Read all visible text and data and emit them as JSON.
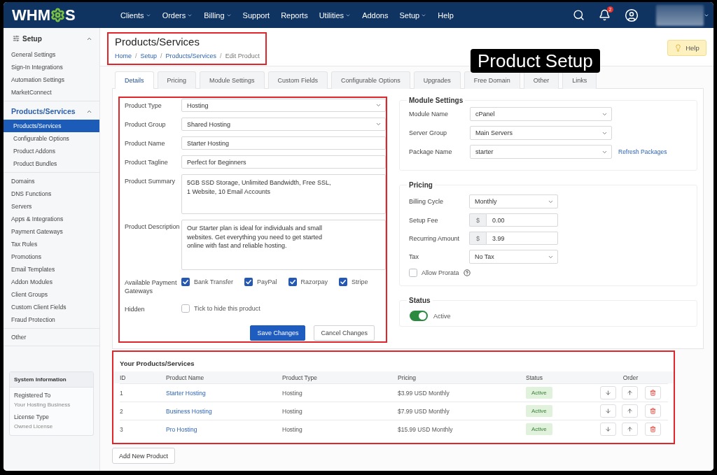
{
  "top_nav": {
    "logo": {
      "before_mark": "WHM",
      "after_mark": "S"
    },
    "menu": [
      {
        "label": "Clients",
        "dropdown": true
      },
      {
        "label": "Orders",
        "dropdown": true
      },
      {
        "label": "Billing",
        "dropdown": true
      },
      {
        "label": "Support",
        "dropdown": false
      },
      {
        "label": "Reports",
        "dropdown": false
      },
      {
        "label": "Utilities",
        "dropdown": true
      },
      {
        "label": "Addons",
        "dropdown": false
      },
      {
        "label": "Setup",
        "dropdown": true
      },
      {
        "label": "Help",
        "dropdown": false
      }
    ],
    "notification_count": "2"
  },
  "sidebar": {
    "groups": [
      {
        "kind": "heading",
        "title": "Setup",
        "expanded": true,
        "items": [
          {
            "label": "General Settings",
            "selected": false
          },
          {
            "label": "Sign-In Integrations",
            "selected": false
          },
          {
            "label": "Automation Settings",
            "selected": false
          },
          {
            "label": "MarketConnect",
            "selected": false
          }
        ]
      },
      {
        "kind": "section",
        "title": "Products/Services",
        "expanded": true,
        "items": [
          {
            "label": "Products/Services",
            "selected": true
          },
          {
            "label": "Configurable Options",
            "selected": false
          },
          {
            "label": "Product Addons",
            "selected": false
          },
          {
            "label": "Product Bundles",
            "selected": false
          }
        ]
      },
      {
        "kind": "list",
        "items": [
          {
            "label": "Domains",
            "selected": false
          },
          {
            "label": "DNS Functions",
            "selected": false
          },
          {
            "label": "Servers",
            "selected": false
          },
          {
            "label": "Apps & Integrations",
            "selected": false
          },
          {
            "label": "Payment Gateways",
            "selected": false
          },
          {
            "label": "Tax Rules",
            "selected": false
          },
          {
            "label": "Promotions",
            "selected": false
          },
          {
            "label": "Email Templates",
            "selected": false
          },
          {
            "label": "Addon Modules",
            "selected": false
          },
          {
            "label": "Client Groups",
            "selected": false
          },
          {
            "label": "Custom Client Fields",
            "selected": false
          },
          {
            "label": "Fraud Protection",
            "selected": false
          }
        ]
      },
      {
        "kind": "list",
        "items": [
          {
            "label": "Other",
            "selected": false
          }
        ]
      }
    ],
    "system_info": {
      "title": "System Information",
      "fields": [
        {
          "label": "Registered To",
          "value": "Your Hosting Business"
        },
        {
          "label": "License Type",
          "value": "Owned License"
        }
      ]
    }
  },
  "page_header": {
    "title": "Products/Services",
    "highlighted": true,
    "breadcrumb": [
      {
        "kind": "link",
        "label": "Home"
      },
      {
        "kind": "separator",
        "label": "/"
      },
      {
        "kind": "link",
        "label": "Setup"
      },
      {
        "kind": "separator",
        "label": "/"
      },
      {
        "kind": "link",
        "label": "Products/Services"
      },
      {
        "kind": "separator",
        "label": "/"
      },
      {
        "kind": "current",
        "label": "Edit Product"
      }
    ],
    "help_button": "Help"
  },
  "annotation": {
    "callout": "Product Setup"
  },
  "tabs": [
    {
      "label": "Details",
      "selected": true
    },
    {
      "label": "Pricing",
      "selected": false
    },
    {
      "label": "Module Settings",
      "selected": false
    },
    {
      "label": "Custom Fields",
      "selected": false
    },
    {
      "label": "Configurable Options",
      "selected": false
    },
    {
      "label": "Upgrades",
      "selected": false
    },
    {
      "label": "Free Domain",
      "selected": false
    },
    {
      "label": "Other",
      "selected": false
    },
    {
      "label": "Links",
      "selected": false
    }
  ],
  "details_form": {
    "highlighted": true,
    "fields": [
      {
        "kind": "select",
        "label": "Product Type",
        "value": "Hosting"
      },
      {
        "kind": "select",
        "label": "Product Group",
        "value": "Shared Hosting"
      },
      {
        "kind": "text",
        "label": "Product Name",
        "value": "Starter Hosting"
      },
      {
        "kind": "text",
        "label": "Product Tagline",
        "value": "Perfect for Beginners"
      },
      {
        "kind": "textarea",
        "label": "Product Summary",
        "value": "5GB SSD Storage, Unlimited Bandwidth, Free SSL,\n1 Website, 10 Email Accounts"
      },
      {
        "kind": "textarea",
        "label": "Product Description",
        "value": "Our Starter plan is ideal for individuals and small\nwebsites. Get everything you need to get started\nonline with fast and reliable hosting."
      },
      {
        "kind": "checkbox_group",
        "label": "Available Payment Gateways",
        "options": [
          {
            "label": "Bank Transfer",
            "checked": true
          },
          {
            "label": "PayPal",
            "checked": true
          },
          {
            "label": "Razorpay",
            "checked": true
          },
          {
            "label": "Stripe",
            "checked": true
          }
        ]
      },
      {
        "kind": "checkbox",
        "label": "Hidden",
        "option": {
          "label": "Tick to hide this product",
          "checked": false
        }
      }
    ],
    "buttons": [
      {
        "kind": "primary",
        "label": "Save Changes"
      },
      {
        "kind": "secondary",
        "label": "Cancel Changes"
      }
    ]
  },
  "module_settings": {
    "title": "Module Settings",
    "fields": [
      {
        "kind": "select",
        "label": "Module Name",
        "value": "cPanel"
      },
      {
        "kind": "select",
        "label": "Server Group",
        "value": "Main Servers"
      },
      {
        "kind": "select",
        "label": "Package Name",
        "value": "starter",
        "link": "Refresh Packages"
      }
    ]
  },
  "pricing": {
    "title": "Pricing",
    "fields": [
      {
        "kind": "select",
        "label": "Billing Cycle",
        "value": "Monthly"
      },
      {
        "kind": "money",
        "label": "Setup Fee",
        "prefix": "$",
        "value": "0.00"
      },
      {
        "kind": "money",
        "label": "Recurring Amount",
        "prefix": "$",
        "value": "3.99"
      },
      {
        "kind": "select",
        "label": "Tax",
        "value": "No Tax"
      },
      {
        "kind": "checkbox",
        "label": "Allow Prorata",
        "checked": false,
        "help": true
      }
    ]
  },
  "status": {
    "title": "Status",
    "on": true,
    "label": "Active"
  },
  "products_table": {
    "title": "Your Products/Services",
    "highlighted": true,
    "columns": [
      "ID",
      "Product Name",
      "Product Type",
      "Pricing",
      "Status",
      "Order"
    ],
    "rows": [
      {
        "id": "1",
        "name": "Starter Hosting",
        "type": "Hosting",
        "pricing": "$3.99 USD Monthly",
        "status": "Active"
      },
      {
        "id": "2",
        "name": "Business Hosting",
        "type": "Hosting",
        "pricing": "$7.99 USD Monthly",
        "status": "Active"
      },
      {
        "id": "3",
        "name": "Pro Hosting",
        "type": "Hosting",
        "pricing": "$15.99 USD Monthly",
        "status": "Active"
      }
    ]
  },
  "add_button": "Add New Product"
}
